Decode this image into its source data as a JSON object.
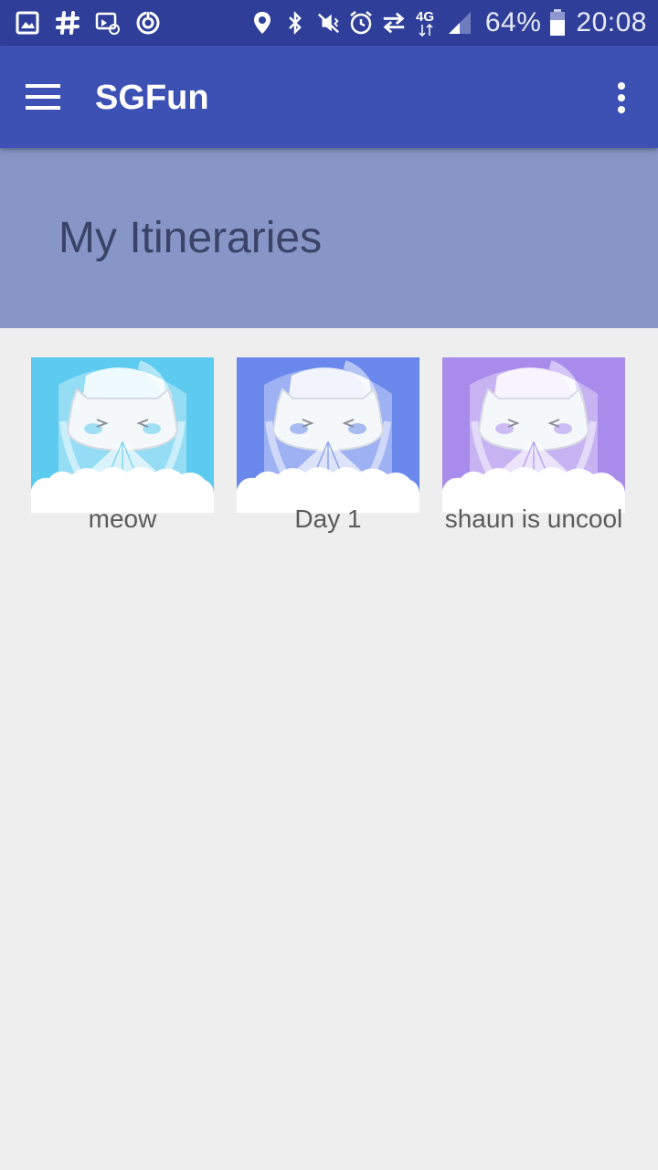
{
  "status_bar": {
    "left_icons": [
      "gallery-icon",
      "slack-icon",
      "email-cast-icon",
      "sync-icon"
    ],
    "right_icons": [
      "location-icon",
      "bluetooth-icon",
      "vibrate-icon",
      "alarm-icon",
      "data-transfer-icon",
      "network-4g-icon",
      "signal-icon",
      "battery-icon"
    ],
    "network_type": "4G",
    "battery_percent": "64%",
    "time": "20:08"
  },
  "app_bar": {
    "title": "SGFun",
    "menu_icon": "hamburger-menu-icon",
    "overflow_icon": "more-vert-icon"
  },
  "header": {
    "title": "My Itineraries"
  },
  "itineraries": [
    {
      "label": "meow",
      "tint": "#5ccbef"
    },
    {
      "label": "Day 1",
      "tint": "#6a88ec"
    },
    {
      "label": "shaun is uncool",
      "tint": "#a98bec"
    }
  ],
  "colors": {
    "status_bar": "#2f3f99",
    "app_bar": "#3d51b5",
    "header_band": "#8796c6",
    "background": "#eeeeee"
  }
}
